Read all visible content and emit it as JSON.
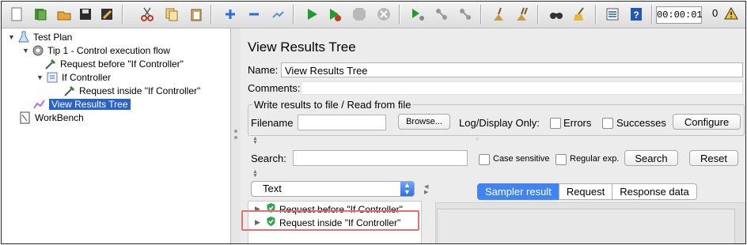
{
  "toolbar": {
    "buttons": [
      {
        "name": "new-icon"
      },
      {
        "name": "templates-icon"
      },
      {
        "name": "open-icon"
      },
      {
        "name": "save-icon"
      },
      {
        "name": "save-as-icon"
      },
      {
        "name": "cut-icon"
      },
      {
        "name": "copy-icon"
      },
      {
        "name": "paste-icon"
      },
      {
        "name": "expand-icon"
      },
      {
        "name": "collapse-icon"
      },
      {
        "name": "toggle-icon"
      },
      {
        "name": "start-icon"
      },
      {
        "name": "start-no-pauses-icon"
      },
      {
        "name": "stop-icon"
      },
      {
        "name": "shutdown-icon"
      },
      {
        "name": "remote-start-icon"
      },
      {
        "name": "remote-stop-icon"
      },
      {
        "name": "remote-shutdown-icon"
      },
      {
        "name": "clear-icon"
      },
      {
        "name": "clear-all-icon"
      },
      {
        "name": "search-binoculars-icon"
      },
      {
        "name": "reset-search-broom-icon"
      },
      {
        "name": "function-helper-icon"
      },
      {
        "name": "help-icon"
      }
    ],
    "timer": "00:00:01",
    "error_count": "0"
  },
  "tree": {
    "items": [
      {
        "label": "Test Plan"
      },
      {
        "label": "Tip 1 - Control execution flow"
      },
      {
        "label": "Request before \"If Controller\""
      },
      {
        "label": "If Controller"
      },
      {
        "label": "Request inside \"If Controller\""
      },
      {
        "label": "View Results Tree"
      },
      {
        "label": "WorkBench"
      }
    ]
  },
  "panel": {
    "title": "View Results Tree",
    "name_label": "Name:",
    "name_value": "View Results Tree",
    "comments_label": "Comments:",
    "write_results_legend": "Write results to file / Read from file",
    "filename_label": "Filename",
    "browse_label": "Browse...",
    "log_display_label": "Log/Display Only:",
    "errors_label": "Errors",
    "successes_label": "Successes",
    "configure_label": "Configure",
    "search_label": "Search:",
    "case_sensitive_label": "Case sensitive",
    "regular_exp_label": "Regular exp.",
    "search_button": "Search",
    "reset_button": "Reset",
    "renderer_selected": "Text",
    "results": [
      {
        "label": "Request before \"If Controller\""
      },
      {
        "label": "Request inside \"If Controller\""
      }
    ],
    "tabs": [
      {
        "label": "Sampler result"
      },
      {
        "label": "Request"
      },
      {
        "label": "Response data"
      }
    ]
  }
}
